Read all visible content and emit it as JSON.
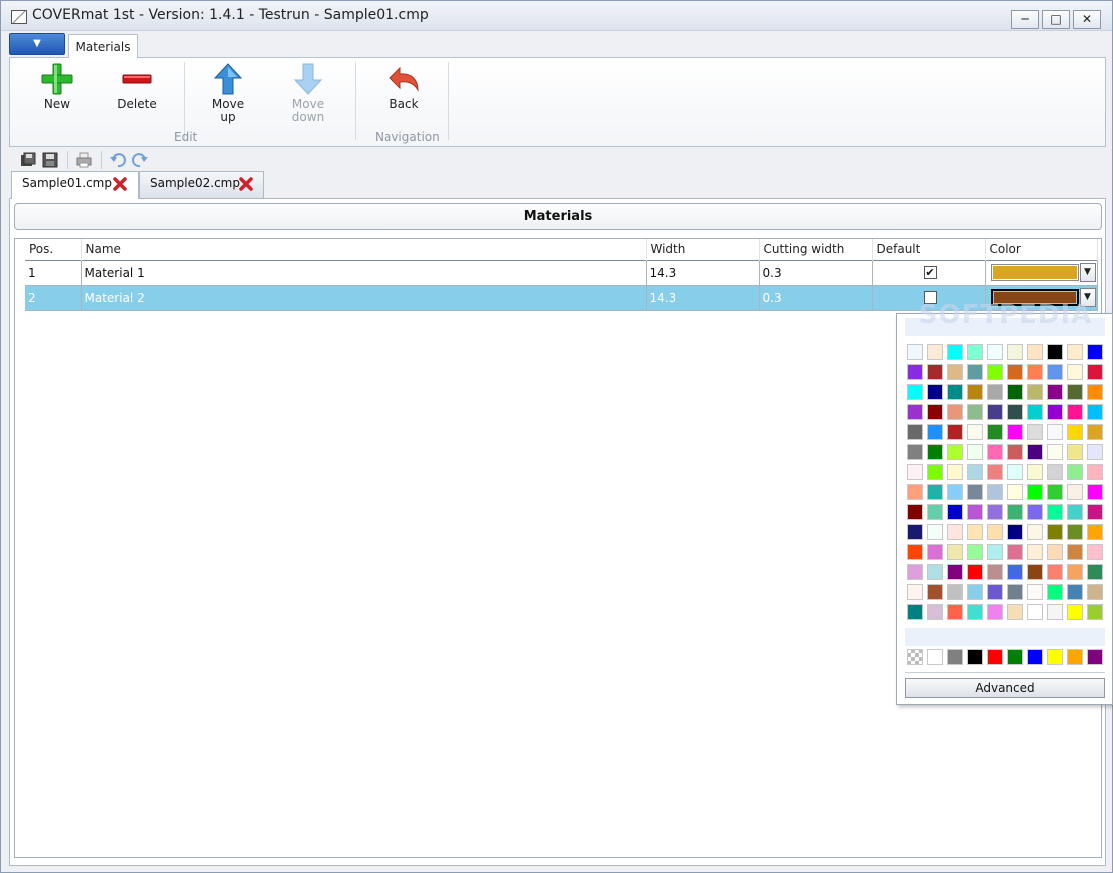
{
  "window": {
    "title": "COVERmat 1st - Version: 1.4.1 - Testrun - Sample01.cmp",
    "minimize_glyph": "─",
    "maximize_glyph": "□",
    "close_glyph": "✕"
  },
  "ribbon": {
    "app_menu_glyph": "▼",
    "tab_label": "Materials",
    "buttons": {
      "new": "New",
      "delete": "Delete",
      "move_up_1": "Move",
      "move_up_2": "up",
      "move_down_1": "Move",
      "move_down_2": "down",
      "back": "Back"
    },
    "groups": {
      "edit": "Edit",
      "navigation": "Navigation"
    }
  },
  "quick_access": {
    "icons": [
      "save-all-icon",
      "save-icon",
      "print-icon",
      "undo-icon",
      "redo-icon"
    ]
  },
  "doc_tabs": [
    {
      "label": "Sample01.cmp",
      "active": true
    },
    {
      "label": "Sample02.cmp",
      "active": false
    }
  ],
  "panel": {
    "title": "Materials"
  },
  "table": {
    "headers": {
      "pos": "Pos.",
      "name": "Name",
      "width": "Width",
      "cutting_width": "Cutting width",
      "default": "Default",
      "color": "Color"
    },
    "rows": [
      {
        "pos": "1",
        "name": "Material 1",
        "width": "14.3",
        "cutting_width": "0.3",
        "default": true,
        "color": "#DAA520"
      },
      {
        "pos": "2",
        "name": "Material 2",
        "width": "14.3",
        "cutting_width": "0.3",
        "default": false,
        "color": "#8B4513"
      }
    ],
    "selected_row": 2
  },
  "color_picker": {
    "watermark": "SOFTPEDIA",
    "available_colors": [
      "#F0F8FF",
      "#FAEBD7",
      "#00FFFF",
      "#7FFFD4",
      "#F0FFFF",
      "#F5F5DC",
      "#FFE4C4",
      "#000000",
      "#FFEBCD",
      "#0000FF",
      "#8A2BE2",
      "#A52A2A",
      "#DEB887",
      "#5F9EA0",
      "#7FFF00",
      "#D2691E",
      "#FF7F50",
      "#6495ED",
      "#FFF8DC",
      "#DC143C",
      "#00FFFF",
      "#00008B",
      "#008B8B",
      "#B8860B",
      "#A9A9A9",
      "#006400",
      "#BDB76B",
      "#8B008B",
      "#556B2F",
      "#FF8C00",
      "#9932CC",
      "#8B0000",
      "#E9967A",
      "#8FBC8F",
      "#483D8B",
      "#2F4F4F",
      "#00CED1",
      "#9400D3",
      "#FF1493",
      "#00BFFF",
      "#696969",
      "#1E90FF",
      "#B22222",
      "#FFFAF0",
      "#228B22",
      "#FF00FF",
      "#DCDCDC",
      "#F8F8FF",
      "#FFD700",
      "#DAA520",
      "#808080",
      "#008000",
      "#ADFF2F",
      "#F0FFF0",
      "#FF69B4",
      "#CD5C5C",
      "#4B0082",
      "#FFFFF0",
      "#F0E68C",
      "#E6E6FA",
      "#FFF0F5",
      "#7CFC00",
      "#FFFACD",
      "#ADD8E6",
      "#F08080",
      "#E0FFFF",
      "#FAFAD2",
      "#D3D3D3",
      "#90EE90",
      "#FFB6C1",
      "#FFA07A",
      "#20B2AA",
      "#87CEFA",
      "#778899",
      "#B0C4DE",
      "#FFFFE0",
      "#00FF00",
      "#32CD32",
      "#FAF0E6",
      "#FF00FF",
      "#800000",
      "#66CDAA",
      "#0000CD",
      "#BA55D3",
      "#9370DB",
      "#3CB371",
      "#7B68EE",
      "#00FA9A",
      "#48D1CC",
      "#C71585",
      "#191970",
      "#F5FFFA",
      "#FFE4E1",
      "#FFE4B5",
      "#FFDEAD",
      "#000080",
      "#FDF5E6",
      "#808000",
      "#6B8E23",
      "#FFA500",
      "#FF4500",
      "#DA70D6",
      "#EEE8AA",
      "#98FB98",
      "#AFEEEE",
      "#DB7093",
      "#FFEFD5",
      "#FFDAB9",
      "#CD853F",
      "#FFC0CB",
      "#DDA0DD",
      "#B0E0E6",
      "#800080",
      "#FF0000",
      "#BC8F8F",
      "#4169E1",
      "#8B4513",
      "#FA8072",
      "#F4A460",
      "#2E8B57",
      "#FFF5EE",
      "#A0522D",
      "#C0C0C0",
      "#87CEEB",
      "#6A5ACD",
      "#708090",
      "#FFFAFA",
      "#00FF7F",
      "#4682B4",
      "#D2B48C",
      "#008080",
      "#D8BFD8",
      "#FF6347",
      "#40E0D0",
      "#EE82EE",
      "#F5DEB3",
      "#FFFFFF",
      "#F5F5F5",
      "#FFFF00",
      "#9ACD32"
    ],
    "standard_colors": [
      "transparent",
      "#FFFFFF",
      "#808080",
      "#000000",
      "#FF0000",
      "#008000",
      "#0000FF",
      "#FFFF00",
      "#FFA500",
      "#800080"
    ],
    "advanced_label": "Advanced"
  }
}
